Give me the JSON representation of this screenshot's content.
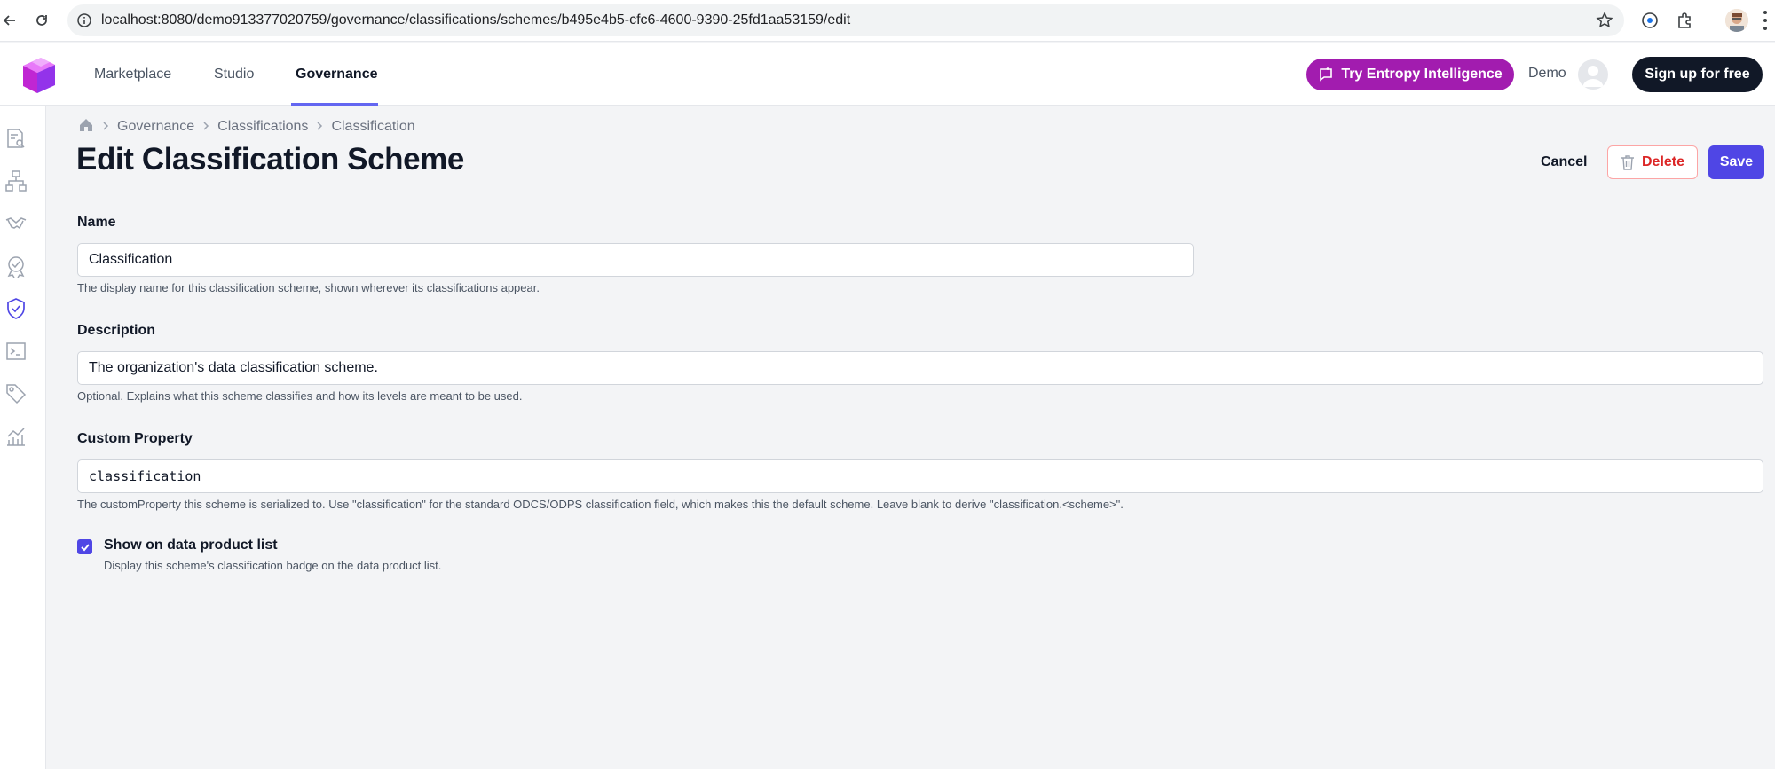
{
  "browser": {
    "url": "localhost:8080/demo913377020759/governance/classifications/schemes/b495e4b5-cfc6-4600-9390-25fd1aa53159/edit"
  },
  "header": {
    "nav": [
      {
        "label": "Marketplace"
      },
      {
        "label": "Studio"
      },
      {
        "label": "Governance"
      }
    ],
    "active_nav": "Governance",
    "ai_button": "Try Entropy Intelligence",
    "user_label": "Demo",
    "signup_button": "Sign up for free"
  },
  "sidebar": {
    "icons": [
      "search-document-icon",
      "hierarchy-icon",
      "handshake-icon",
      "certificate-icon",
      "shield-check-icon",
      "terminal-icon",
      "tags-icon",
      "analytics-icon"
    ],
    "active_icon": "shield-check-icon"
  },
  "breadcrumb": [
    "Governance",
    "Classifications",
    "Classification"
  ],
  "page": {
    "title": "Edit Classification Scheme",
    "cancel": "Cancel",
    "delete": "Delete",
    "save": "Save"
  },
  "form": {
    "name": {
      "label": "Name",
      "value": "Classification",
      "help": "The display name for this classification scheme, shown wherever its classifications appear."
    },
    "description": {
      "label": "Description",
      "value": "The organization's data classification scheme.",
      "help": "Optional. Explains what this scheme classifies and how its levels are meant to be used."
    },
    "custom_property": {
      "label": "Custom Property",
      "value": "classification",
      "help": "The customProperty this scheme is serialized to. Use \"classification\" for the standard ODCS/ODPS classification field, which makes this the default scheme. Leave blank to derive \"classification.<scheme>\"."
    },
    "show_on_list": {
      "label": "Show on data product list",
      "help": "Display this scheme's classification badge on the data product list.",
      "checked": true
    }
  },
  "colors": {
    "primary": "#4f46e5",
    "ai_button": "#a21caf",
    "danger": "#dc2626",
    "nav_underline": "#6366f1"
  }
}
